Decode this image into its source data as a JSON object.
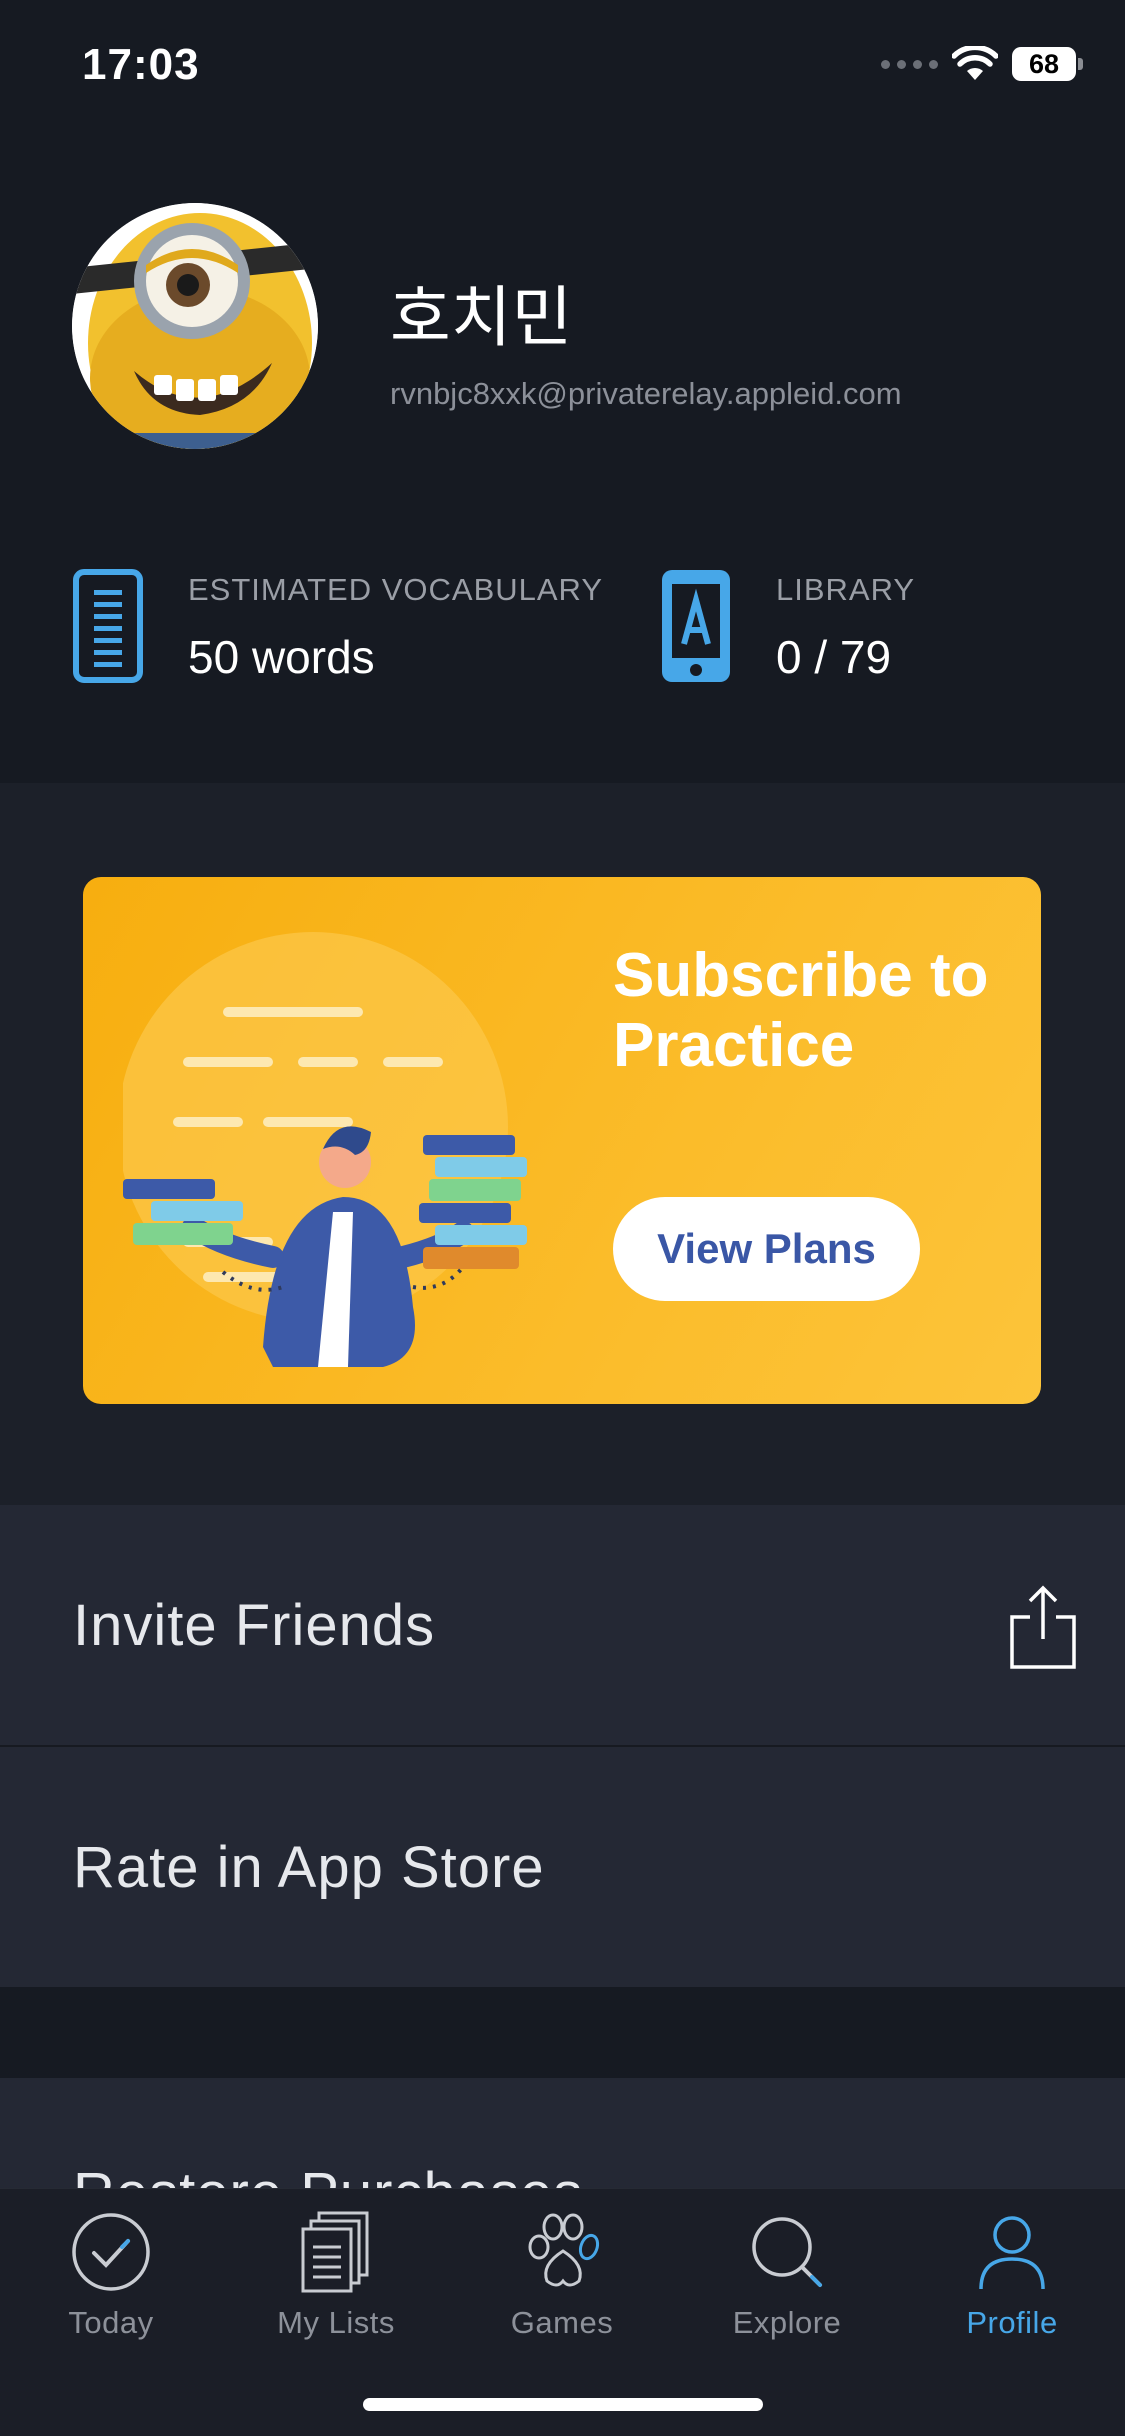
{
  "status_bar": {
    "time": "17:03",
    "battery": "68"
  },
  "profile": {
    "name": "호치민",
    "email": "rvnbjc8xxk@privaterelay.appleid.com"
  },
  "stats": [
    {
      "label": "ESTIMATED VOCABULARY",
      "value": "50 words",
      "icon": "vocabulary-list-icon"
    },
    {
      "label": "LIBRARY",
      "value": "0 / 79",
      "icon": "phone-letter-a-icon"
    }
  ],
  "banner": {
    "title": "Subscribe to Practice",
    "button_label": "View Plans"
  },
  "rows": {
    "invite": "Invite Friends",
    "rate": "Rate in App Store",
    "restore": "Restore Purchases"
  },
  "tabs": [
    {
      "label": "Today",
      "icon": "check-circle-icon",
      "active": false
    },
    {
      "label": "My Lists",
      "icon": "document-stack-icon",
      "active": false
    },
    {
      "label": "Games",
      "icon": "paw-icon",
      "active": false
    },
    {
      "label": "Explore",
      "icon": "magnifier-icon",
      "active": false
    },
    {
      "label": "Profile",
      "icon": "person-icon",
      "active": true
    }
  ],
  "colors": {
    "background": "#161a22",
    "row_background": "#242834",
    "accent_blue": "#47a7e8",
    "banner_yellow": "#f7ae0f",
    "button_text": "#3a57a6"
  }
}
